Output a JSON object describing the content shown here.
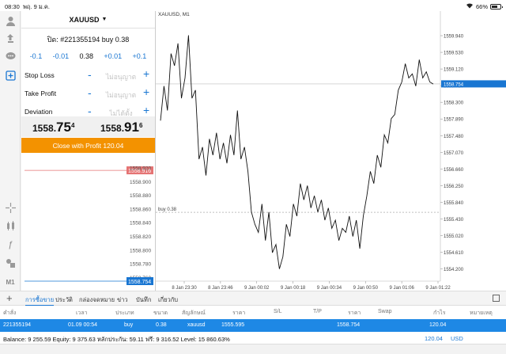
{
  "status": {
    "time": "08:30",
    "date": "พฤ. 9 ม.ค.",
    "battery": "66%"
  },
  "toolbar": {
    "icons": [
      "person-icon",
      "trade-arrows-icon",
      "chat-icon",
      "new-order-icon"
    ],
    "drawing_icons": [
      "crosshair-icon",
      "indicators-icon",
      "function-icon",
      "objects-icon"
    ],
    "timeframe": "M1"
  },
  "order": {
    "symbol": "XAUUSD",
    "title": "ปิด: #221355194 buy 0.38",
    "volume": {
      "minus_big": "-0.1",
      "minus_small": "-0.01",
      "value": "0.38",
      "plus_small": "+0.01",
      "plus_big": "+0.1"
    },
    "stop_loss": {
      "label": "Stop Loss",
      "value": "ไม่อนุญาต"
    },
    "take_profit": {
      "label": "Take Profit",
      "value": "ไม่อนุญาต"
    },
    "deviation": {
      "label": "Deviation",
      "value": "ไม่ได้ตั้ง"
    },
    "bid": {
      "main": "1558.",
      "big": "75",
      "sup": "4"
    },
    "ask": {
      "main": "1558.",
      "big": "91",
      "sup": "6"
    },
    "close_label": "Close with Profit 120.04",
    "minus_sign": "-",
    "plus_sign": "+"
  },
  "depth": {
    "ask_label": "1558.916",
    "bid_label": "1558.754",
    "levels": [
      "1558.920",
      "1558.900",
      "1558.880",
      "1558.860",
      "1558.840",
      "1558.820",
      "1558.800",
      "1558.780",
      "1558.760"
    ]
  },
  "chart_data": {
    "type": "line",
    "title": "XAUUSD, M1",
    "y_ticks": [
      "1559.940",
      "1559.530",
      "1559.120",
      "1558.710",
      "1558.300",
      "1557.890",
      "1557.480",
      "1557.070",
      "1556.660",
      "1556.250",
      "1555.840",
      "1555.430",
      "1555.020",
      "1554.610",
      "1554.200"
    ],
    "x_ticks": [
      "8 Jan 23:30",
      "8 Jan 23:46",
      "9 Jan 00:02",
      "9 Jan 00:18",
      "9 Jan 00:34",
      "9 Jan 00:50",
      "9 Jan 01:06",
      "9 Jan 01:22"
    ],
    "current_price": "1558.754",
    "entry_label": "buy 0.38",
    "entry_price": 1555.595,
    "ylim": [
      1553.9,
      1560.35
    ],
    "series": [
      {
        "values": [
          1557.85,
          1558.7,
          1558.1,
          1559.5,
          1559.2,
          1559.75,
          1558.4,
          1558.9,
          1559.95,
          1558.4,
          1558.6,
          1556.9,
          1557.2,
          1556.5,
          1557.4,
          1557.0,
          1557.55,
          1556.9,
          1557.3,
          1556.8,
          1557.5,
          1557.0,
          1558.1,
          1556.9,
          1557.2,
          1556.6,
          1555.6,
          1555.3,
          1555.1,
          1555.8,
          1554.9,
          1555.6,
          1554.6,
          1554.8,
          1554.2,
          1554.5,
          1555.3,
          1555.0,
          1555.8,
          1555.5,
          1556.3,
          1555.9,
          1556.25,
          1555.7,
          1556.0,
          1555.6,
          1555.9,
          1555.4,
          1555.7,
          1555.2,
          1555.4,
          1554.9,
          1555.2,
          1555.1,
          1555.5,
          1555.0,
          1555.4,
          1554.7,
          1555.5,
          1556.0,
          1556.6,
          1556.3,
          1557.0,
          1556.7,
          1557.5,
          1557.3,
          1557.9,
          1558.0,
          1558.6,
          1558.8,
          1559.25,
          1558.9,
          1559.0,
          1558.7,
          1559.35,
          1558.9,
          1559.05,
          1558.8,
          1558.75
        ]
      }
    ]
  },
  "tabs": [
    "การซื้อขาย",
    "ประวัติ",
    "กล่องจดหมาย",
    "ข่าว",
    "บันทึก",
    "เกี่ยวกับ"
  ],
  "table": {
    "headers": [
      "คำสั่ง",
      "เวลา",
      "ประเภท",
      "ขนาด",
      "สัญลักษณ์",
      "ราคา",
      "S/L",
      "T/P",
      "ราคา",
      "Swap",
      "กำไร",
      "หมายเหตุ"
    ],
    "row": [
      "221355194",
      "01.09 00:54",
      "buy",
      "0.38",
      "xauusd",
      "1555.595",
      "",
      "",
      "1558.754",
      "",
      "120.04",
      ""
    ]
  },
  "balance": {
    "text": "Balance: 9 255.59 Equity: 9 375.63 หลักประกัน: 59.11 ฟรี: 9 316.52 Level: 15 860.63%",
    "profit": "120.04",
    "currency": "USD"
  }
}
